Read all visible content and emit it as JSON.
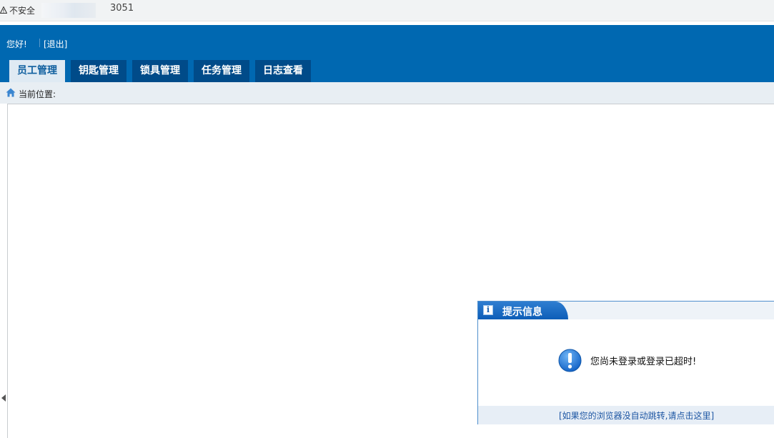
{
  "browser": {
    "security_label": "不安全",
    "url_port": "3051"
  },
  "header": {
    "greeting": "您好!",
    "logout_label": "[退出]",
    "tabs": [
      {
        "label": "员工管理",
        "active": true
      },
      {
        "label": "钥匙管理",
        "active": false
      },
      {
        "label": "锁具管理",
        "active": false
      },
      {
        "label": "任务管理",
        "active": false
      },
      {
        "label": "日志查看",
        "active": false
      }
    ]
  },
  "breadcrumb": {
    "label": "当前位置:"
  },
  "dialog": {
    "title": "提示信息",
    "message": "您尚未登录或登录已超时!",
    "redirect_link": "[如果您的浏览器没自动跳转,请点击这里]"
  },
  "colors": {
    "header_blue": "#0068b1",
    "tab_dark": "#004b89",
    "tab_active_bg": "#dfeaf3",
    "dialog_blue": "#1f6fc4"
  }
}
